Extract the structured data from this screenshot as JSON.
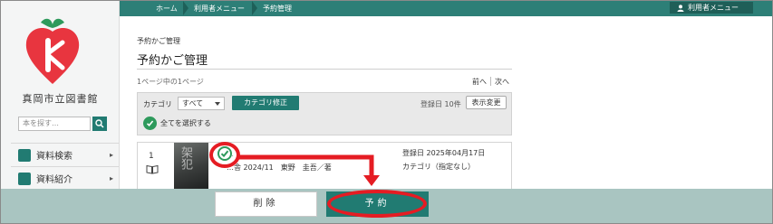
{
  "sidebar": {
    "library_name": "真岡市立図書館",
    "search_placeholder": "本を探す…",
    "items": [
      {
        "label": "資料検索",
        "icon": "search-doc-icon"
      },
      {
        "label": "資料紹介",
        "icon": "book-intro-icon"
      }
    ]
  },
  "topbar": {
    "breadcrumbs": [
      "ホーム",
      "利用者メニュー",
      "予約管理"
    ],
    "user_menu_label": "利用者メニュー"
  },
  "main": {
    "sub_title": "予約かご管理",
    "page_title": "予約かご管理",
    "page_info": "1ページ中の1ページ",
    "pager": {
      "prev": "前へ",
      "next": "次へ"
    },
    "filter": {
      "category_label": "カテゴリ",
      "category_value": "すべて",
      "category_edit": "カテゴリ修正",
      "reg_count": "登録日 10件",
      "display_change": "表示変更",
      "select_all": "全てを選択する"
    },
    "item": {
      "number": "1",
      "cover_text": "架犯",
      "title": "…",
      "meta": "…舎 2024/11　東野　圭吾／著",
      "reg_date": "登録日 2025年04月17日",
      "category": "カテゴリ（指定なし）"
    }
  },
  "bottom": {
    "delete_label": "削除",
    "reserve_label": "予約"
  },
  "colors": {
    "accent": "#217b72",
    "topbar": "#2d7f77",
    "bottom_bar": "#a9c5c1",
    "annotation": "#e51c23",
    "check": "#2e9a5c"
  }
}
